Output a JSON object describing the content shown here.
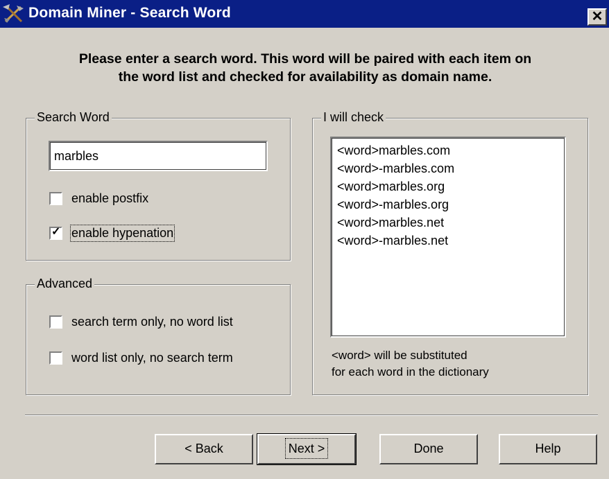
{
  "window": {
    "title": "Domain Miner - Search Word",
    "close_label": "✕"
  },
  "instructions": {
    "line1": "Please enter a search word. This word will be paired with each item on",
    "line2": "the word list and checked for availability as domain name."
  },
  "search_word_group": {
    "label": "Search Word",
    "input_value": "marbles",
    "enable_postfix": {
      "label": "enable postfix",
      "checked": false
    },
    "enable_hypenation": {
      "label": "enable hypenation",
      "checked": true
    }
  },
  "advanced_group": {
    "label": "Advanced",
    "search_term_only": {
      "label": "search term only, no word list",
      "checked": false
    },
    "word_list_only": {
      "label": "word list only, no search term",
      "checked": false
    }
  },
  "check_group": {
    "label": "I will check",
    "items": [
      "<word>marbles.com",
      "<word>-marbles.com",
      "<word>marbles.org",
      "<word>-marbles.org",
      "<word>marbles.net",
      "<word>-marbles.net"
    ],
    "note_line1": "<word> will be substituted",
    "note_line2": "for each word in the dictionary"
  },
  "buttons": {
    "back": "< Back",
    "next": "Next >",
    "done": "Done",
    "help": "Help"
  },
  "colors": {
    "titlebar": "#0a1f86",
    "face": "#d4d0c8"
  }
}
